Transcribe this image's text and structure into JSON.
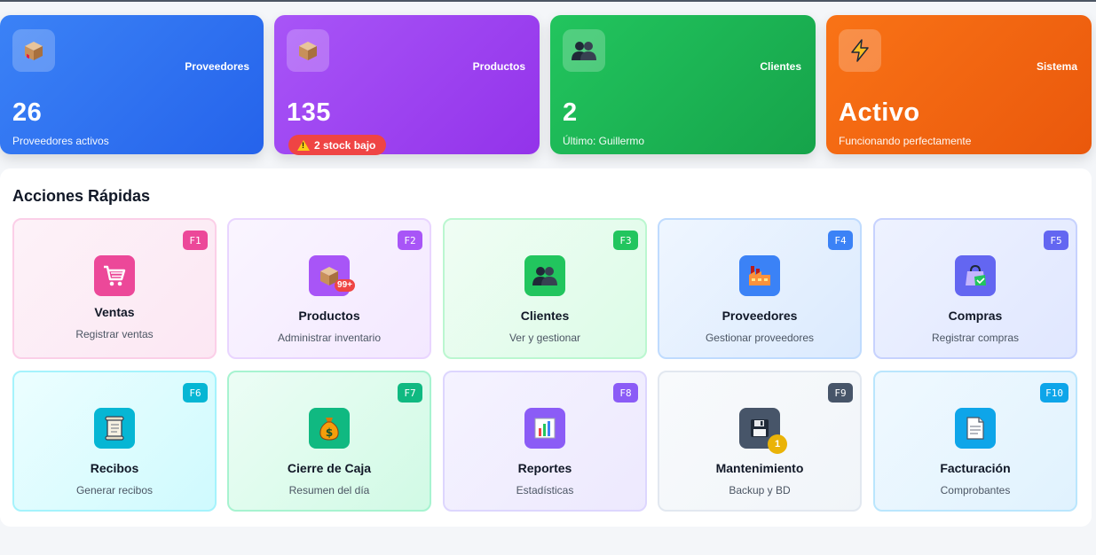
{
  "stats": [
    {
      "label": "Proveedores",
      "value": "26",
      "sub": "Proveedores activos",
      "icon": "package-icon"
    },
    {
      "label": "Productos",
      "value": "135",
      "pill": "2 stock bajo",
      "icon": "package-icon"
    },
    {
      "label": "Clientes",
      "value": "2",
      "sub": "Último: Guillermo",
      "icon": "people-icon"
    },
    {
      "label": "Sistema",
      "value": "Activo",
      "sub": "Funcionando perfectamente",
      "icon": "lightning-icon"
    }
  ],
  "quick_actions": {
    "title": "Acciones Rápidas",
    "items": [
      {
        "key": "F1",
        "title": "Ventas",
        "desc": "Registrar ventas",
        "icon": "shopping-cart-icon",
        "color": "#ec4899"
      },
      {
        "key": "F2",
        "title": "Productos",
        "desc": "Administrar inventario",
        "icon": "package-icon",
        "badge": "99+",
        "color": "#a855f7"
      },
      {
        "key": "F3",
        "title": "Clientes",
        "desc": "Ver y gestionar",
        "icon": "people-icon",
        "color": "#22c55e"
      },
      {
        "key": "F4",
        "title": "Proveedores",
        "desc": "Gestionar proveedores",
        "icon": "factory-icon",
        "color": "#3b82f6"
      },
      {
        "key": "F5",
        "title": "Compras",
        "desc": "Registrar compras",
        "icon": "shopping-bag-icon",
        "color": "#6366f1"
      },
      {
        "key": "F6",
        "title": "Recibos",
        "desc": "Generar recibos",
        "icon": "scroll-icon",
        "color": "#06b6d4"
      },
      {
        "key": "F7",
        "title": "Cierre de Caja",
        "desc": "Resumen del día",
        "icon": "money-bag-icon",
        "color": "#10b981"
      },
      {
        "key": "F8",
        "title": "Reportes",
        "desc": "Estadísticas",
        "icon": "bar-chart-icon",
        "color": "#8b5cf6"
      },
      {
        "key": "F9",
        "title": "Mantenimiento",
        "desc": "Backup y BD",
        "icon": "floppy-disk-icon",
        "badge": "1",
        "color": "#475569"
      },
      {
        "key": "F10",
        "title": "Facturación",
        "desc": "Comprobantes",
        "icon": "document-icon",
        "color": "#0ea5e9"
      }
    ]
  }
}
